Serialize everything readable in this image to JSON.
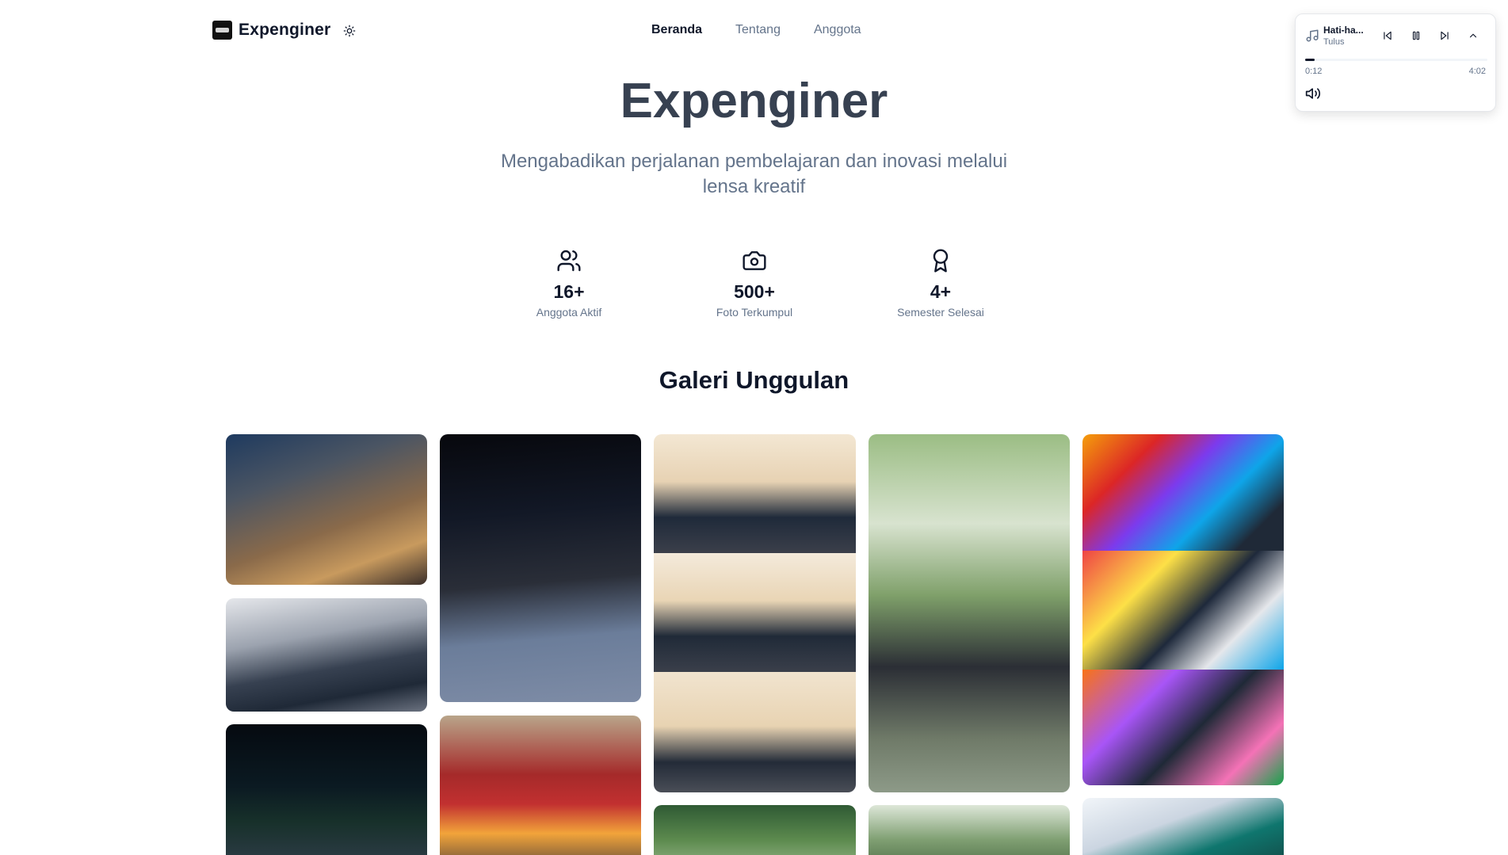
{
  "header": {
    "brand": "Expenginer",
    "nav": [
      "Beranda",
      "Tentang",
      "Anggota"
    ]
  },
  "player": {
    "title": "Hati-ha...",
    "artist": "Tulus",
    "current_time": "0:12",
    "total_time": "4:02",
    "progress": 0.05
  },
  "hero": {
    "title": "Expenginer",
    "subtitle": "Mengabadikan perjalanan pembelajaran dan inovasi melalui lensa kreatif"
  },
  "stats": [
    {
      "icon": "users-icon",
      "value": "16+",
      "label": "Anggota Aktif"
    },
    {
      "icon": "camera-icon",
      "value": "500+",
      "label": "Foto Terkumpul"
    },
    {
      "icon": "award-icon",
      "value": "4+",
      "label": "Semester Selesai"
    }
  ],
  "gallery": {
    "title": "Galeri Unggulan"
  },
  "colors": {
    "heading": "#374151",
    "text": "#0f172a",
    "muted": "#64748b"
  }
}
